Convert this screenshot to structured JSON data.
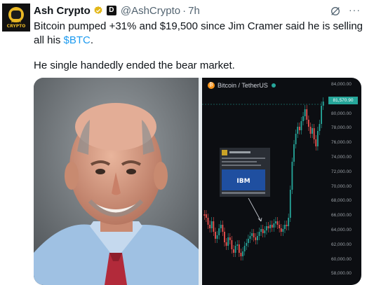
{
  "author": {
    "name": "Ash Crypto",
    "handle": "@AshCrypto",
    "time": "7h",
    "avatar_text": "ASH CRYPTO",
    "affiliate_badge": "D"
  },
  "post": {
    "line1_pre": "Bitcoin pumped +31% and $19,500 since Jim Cramer said he is selling all his ",
    "cashtag": "$BTC",
    "line1_post": ".",
    "line2": "He single handedly ended the bear market."
  },
  "icons": {
    "verified": "verified-badge-icon",
    "grok": "grok-icon",
    "more": "more-icon"
  },
  "chart": {
    "title": "Bitcoin / TetherUS",
    "current_price": "81,570.90",
    "y_ticks": [
      "84,000.00",
      "82,000.00",
      "80,000.00",
      "78,000.00",
      "76,000.00",
      "74,000.00",
      "72,000.00",
      "70,000.00",
      "68,000.00",
      "66,000.00",
      "64,000.00",
      "62,000.00",
      "60,000.00",
      "58,000.00"
    ],
    "inset_logo": "IBM"
  },
  "colors": {
    "up": "#26a69a",
    "down": "#ef5350",
    "cashtag": "#1d9bf0",
    "handle": "#536471"
  }
}
